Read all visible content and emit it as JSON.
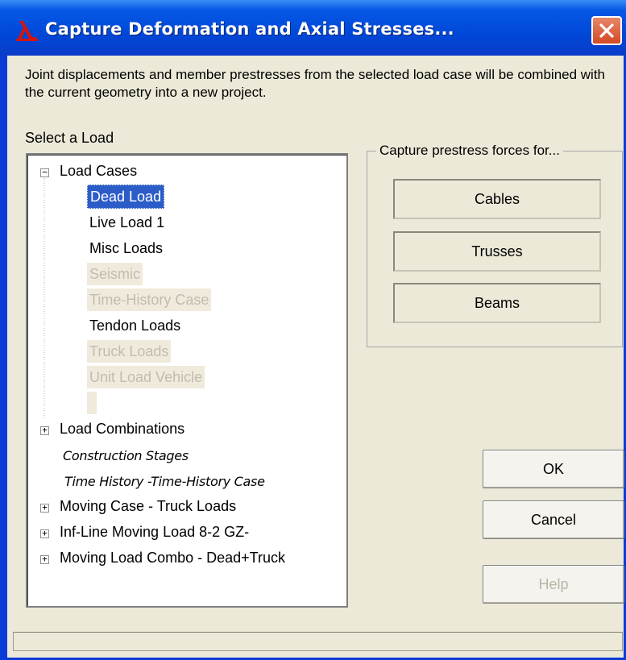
{
  "window": {
    "title": "Capture Deformation and Axial Stresses...",
    "app_icon": "lambda-logo-icon",
    "close_icon": "close-icon"
  },
  "description": "Joint displacements and member prestresses from the selected load case will be combined with the current geometry into a new project.",
  "select_label": "Select a Load",
  "tree": {
    "load_cases": {
      "label": "Load Cases",
      "expander": "−",
      "items": [
        {
          "label": "Dead Load",
          "state": "selected"
        },
        {
          "label": "Live Load 1",
          "state": "enabled"
        },
        {
          "label": "Misc Loads",
          "state": "enabled"
        },
        {
          "label": "Seismic",
          "state": "disabled"
        },
        {
          "label": "Time-History Case",
          "state": "disabled"
        },
        {
          "label": "Tendon Loads",
          "state": "enabled"
        },
        {
          "label": "Truck Loads",
          "state": "disabled"
        },
        {
          "label": "Unit Load Vehicle",
          "state": "disabled"
        }
      ]
    },
    "load_combinations": {
      "label": "Load Combinations",
      "expander": "+"
    },
    "construction_stages": "Construction Stages",
    "time_history": "Time History -Time-History Case",
    "moving_case": {
      "label": "Moving Case - Truck Loads",
      "expander": "+"
    },
    "inf_line": {
      "label": "Inf-Line Moving Load 8-2 GZ-",
      "expander": "+"
    },
    "moving_combo": {
      "label": "Moving Load Combo - Dead+Truck",
      "expander": "+"
    }
  },
  "prestress": {
    "group_title": "Capture prestress forces for...",
    "cables": "Cables",
    "trusses": "Trusses",
    "beams": "Beams"
  },
  "buttons": {
    "ok": "OK",
    "cancel": "Cancel",
    "help": "Help"
  },
  "colors": {
    "title_bar": "#0054e3",
    "selection": "#2b5cc8",
    "dialog_bg": "#ece9d8"
  }
}
